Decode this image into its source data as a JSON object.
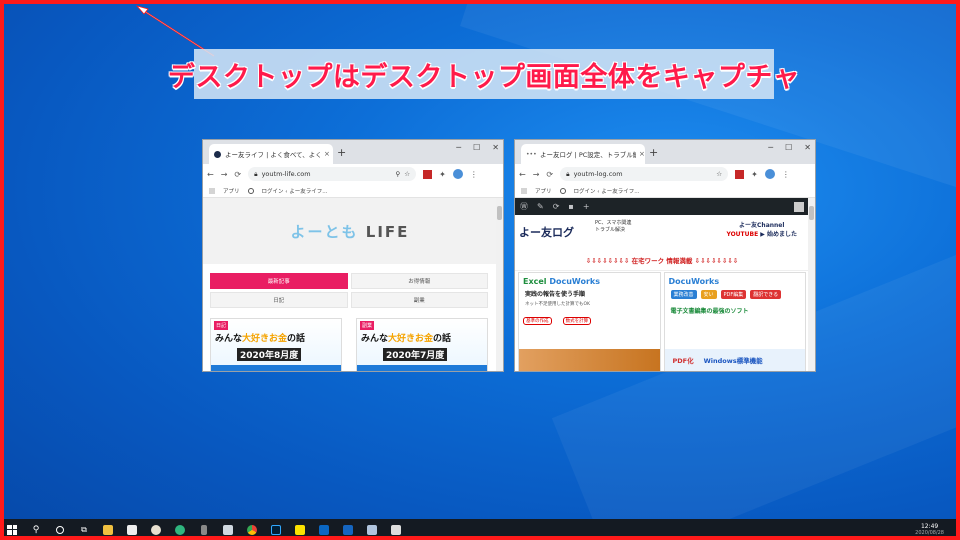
{
  "annotation": {
    "callout_text": "デスクトップはデスクトップ画面全体をキャプチャ"
  },
  "browser_left": {
    "tab_title": "よー友ライフ | よく食べて、よく遊び、",
    "url": "youtm-life.com",
    "bookmarks": [
      "アプリ",
      "ログイン ‹ よー友ライフ..."
    ],
    "site": {
      "logo_a": "よーとも",
      "logo_b": "LIFE",
      "tabs": [
        "最新記事",
        "お得情報",
        "日記",
        "副業"
      ],
      "cards": [
        {
          "badge": "日記",
          "title_pre": "みんな",
          "title_hl": "大好き",
          "title_mid": "お金",
          "title_post": "の話",
          "sub": "2020年8月度"
        },
        {
          "badge": "副業",
          "title_pre": "みんな",
          "title_hl": "大好き",
          "title_mid": "お金",
          "title_post": "の話",
          "sub": "2020年7月度"
        }
      ]
    }
  },
  "browser_right": {
    "tab_title": "よー友ログ | PC設定、トラブル解決",
    "url": "youtm-log.com",
    "bookmarks": [
      "アプリ",
      "ログイン ‹ よー友ライフ..."
    ],
    "site": {
      "title": "よー友ログ",
      "sub": "PC、スマホ関連\nトラブル解決",
      "yt_line1": "よー友Channel",
      "yt_line2": "YOUTUBE",
      "yt_line3": "始めました",
      "ticker": "⇩⇩⇩⇩⇩⇩⇩⇩ 在宅ワーク 情報満載 ⇩⇩⇩⇩⇩⇩⇩⇩",
      "card1": {
        "hd_g": "Excel",
        "hd": "DocuWorks",
        "body": "実践の報告を使う手順",
        "small": "ネット不足使用した計算でもOK",
        "pill1": "基準の作成",
        "pill2": "数式を計算"
      },
      "card2": {
        "hd": "DocuWorks",
        "tag1": "業務改善",
        "tag2": "安い",
        "tag3": "PDF編集",
        "tag4": "翻訳できる",
        "body": "電子文書編集の最強のソフト",
        "foot_a": "PDF化",
        "foot_b": "Windows標準機能"
      }
    }
  },
  "taskbar": {
    "time": "12:49",
    "date": "2020/08/28"
  },
  "colors": {
    "frame": "#ff1a1a",
    "callout_text": "#ff1a4a",
    "accent_pink": "#e91e63"
  }
}
